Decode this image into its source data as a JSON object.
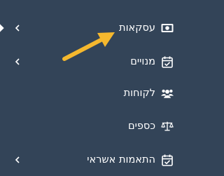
{
  "menu": {
    "items": [
      {
        "label": "עסקאות",
        "icon": "cash-icon",
        "has_submenu": true,
        "active": true
      },
      {
        "label": "מנויים",
        "icon": "calendar-check-icon",
        "has_submenu": true
      },
      {
        "label": "לקוחות",
        "icon": "users-icon",
        "has_submenu": false
      },
      {
        "label": "כספים",
        "icon": "scale-icon",
        "has_submenu": false
      },
      {
        "label": "התאמות אשראי",
        "icon": "calendar-check-icon",
        "has_submenu": true
      }
    ]
  },
  "annotation": {
    "icon": "pointer-arrow",
    "color": "#f5b82e"
  },
  "colors": {
    "background": "#334458",
    "text": "#ffffff"
  }
}
